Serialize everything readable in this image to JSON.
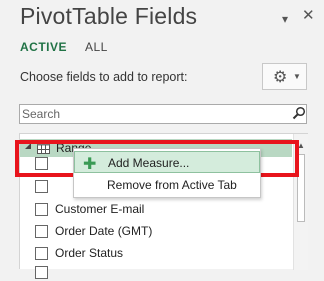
{
  "header": {
    "title": "PivotTable Fields",
    "dropdown_icon": "chevron-down-icon",
    "close_icon": "close-icon"
  },
  "tabs": [
    {
      "label": "ACTIVE",
      "active": true
    },
    {
      "label": "ALL",
      "active": false
    }
  ],
  "choose_label": "Choose fields to add to report:",
  "tools_button": {
    "icon": "gear-icon"
  },
  "search": {
    "placeholder": "Search",
    "value": ""
  },
  "field_list": {
    "table_name": "Range",
    "fields": [
      {
        "label": "",
        "checked": false
      },
      {
        "label": "",
        "checked": false
      },
      {
        "label": "Customer E-mail",
        "checked": false
      },
      {
        "label": "Order Date (GMT)",
        "checked": false
      },
      {
        "label": "Order Status",
        "checked": false
      },
      {
        "label": "",
        "checked": false
      }
    ]
  },
  "context_menu": {
    "items": [
      {
        "label": "Add Measure...",
        "icon": "plus-icon"
      },
      {
        "label": "Remove from Active Tab"
      }
    ]
  },
  "colors": {
    "accent": "#217346",
    "selection": "#b9d8c3",
    "highlight": "#e8141c"
  }
}
